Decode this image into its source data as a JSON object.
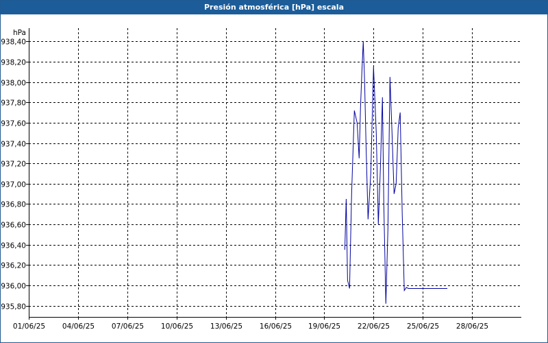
{
  "window": {
    "title": "Presión atmosférica [hPa] escala"
  },
  "colors": {
    "titlebar": "#1c5d99",
    "series": "#0000a0",
    "grid": "#000000",
    "axis": "#000000"
  },
  "chart_data": {
    "type": "line",
    "title": "Presión atmosférica [hPa] escala",
    "ylabel": "hPa",
    "xlabel": "",
    "grid": true,
    "xlim": [
      "2025-06-01",
      "2025-07-01"
    ],
    "ylim": [
      935.69,
      938.53
    ],
    "x_ticks": [
      "01/06/25",
      "04/06/25",
      "07/06/25",
      "10/06/25",
      "13/06/25",
      "16/06/25",
      "19/06/25",
      "22/06/25",
      "25/06/25",
      "28/06/25"
    ],
    "y_ticks": [
      "935,80",
      "936,00",
      "936,20",
      "936,40",
      "936,60",
      "936,80",
      "937,00",
      "937,20",
      "937,40",
      "937,60",
      "937,80",
      "938,00",
      "938,20",
      "938,40"
    ],
    "series": [
      {
        "x": [
          "2025-06-20T06:00",
          "2025-06-20T08:00",
          "2025-06-20T10:00",
          "2025-06-20T13:00",
          "2025-06-20T16:00",
          "2025-06-20T20:00",
          "2025-06-21T00:00",
          "2025-06-21T03:00",
          "2025-06-21T05:00",
          "2025-06-21T07:00",
          "2025-06-21T09:00",
          "2025-06-21T11:00",
          "2025-06-21T13:00",
          "2025-06-21T16:00",
          "2025-06-21T20:00",
          "2025-06-22T00:00",
          "2025-06-22T04:00",
          "2025-06-22T07:00",
          "2025-06-22T10:00",
          "2025-06-22T13:00",
          "2025-06-22T15:00",
          "2025-06-22T18:00",
          "2025-06-22T21:00",
          "2025-06-23T00:00",
          "2025-06-23T03:00",
          "2025-06-23T06:00",
          "2025-06-23T09:00",
          "2025-06-23T12:00",
          "2025-06-23T15:00",
          "2025-06-23T18:00",
          "2025-06-23T21:00",
          "2025-06-24T00:00",
          "2025-06-24T03:00",
          "2025-06-24T06:00",
          "2025-06-24T10:00",
          "2025-06-24T14:00",
          "2025-06-24T18:00",
          "2025-06-25T00:00",
          "2025-06-25T12:00",
          "2025-06-26T00:00",
          "2025-06-26T12:00"
        ],
        "y": [
          936.35,
          936.85,
          936.05,
          935.97,
          936.9,
          937.72,
          937.6,
          937.25,
          937.75,
          938.1,
          938.4,
          938.0,
          937.4,
          936.65,
          937.1,
          938.15,
          937.5,
          936.6,
          937.15,
          937.85,
          936.8,
          935.82,
          936.55,
          938.05,
          937.5,
          936.9,
          937.0,
          937.55,
          937.7,
          936.7,
          935.95,
          935.98,
          935.97,
          935.97,
          935.97,
          935.97,
          935.97,
          935.97,
          935.97,
          935.97,
          935.97
        ]
      }
    ]
  }
}
